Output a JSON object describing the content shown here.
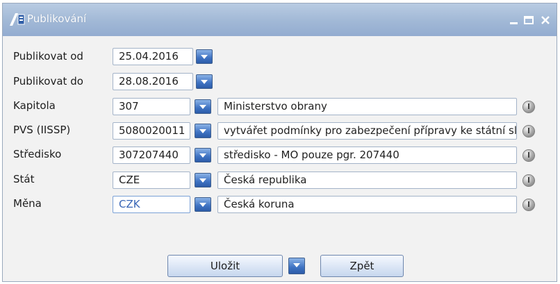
{
  "window": {
    "title": "Publikování"
  },
  "form": {
    "publikovat_od": {
      "label": "Publikovat od",
      "value": "25.04.2016"
    },
    "publikovat_do": {
      "label": "Publikovat do",
      "value": "28.08.2016"
    },
    "kapitola": {
      "label": "Kapitola",
      "value": "307",
      "description": "Ministerstvo obrany"
    },
    "pvs": {
      "label": "PVS (IISSP)",
      "value": "5080020011",
      "description": "vytvářet podmínky pro zabezpečení přípravy ke státní službě"
    },
    "stredisko": {
      "label": "Středisko",
      "value": "307207440",
      "description": "středisko - MO pouze pgr. 207440"
    },
    "stat": {
      "label": "Stát",
      "value": "CZE",
      "description": "Česká republika"
    },
    "mena": {
      "label": "Měna",
      "value": "CZK",
      "description": "Česká koruna"
    }
  },
  "buttons": {
    "save": "Uložit",
    "back": "Zpět"
  },
  "colors": {
    "titlebar": "#a1b8d6",
    "dropdown_accent": "#3e72c2",
    "window_bg": "#f2f2f2"
  },
  "icons": [
    "app-icon",
    "minimize-icon",
    "maximize-icon",
    "close-icon",
    "dropdown-arrow-icon",
    "info-icon"
  ]
}
